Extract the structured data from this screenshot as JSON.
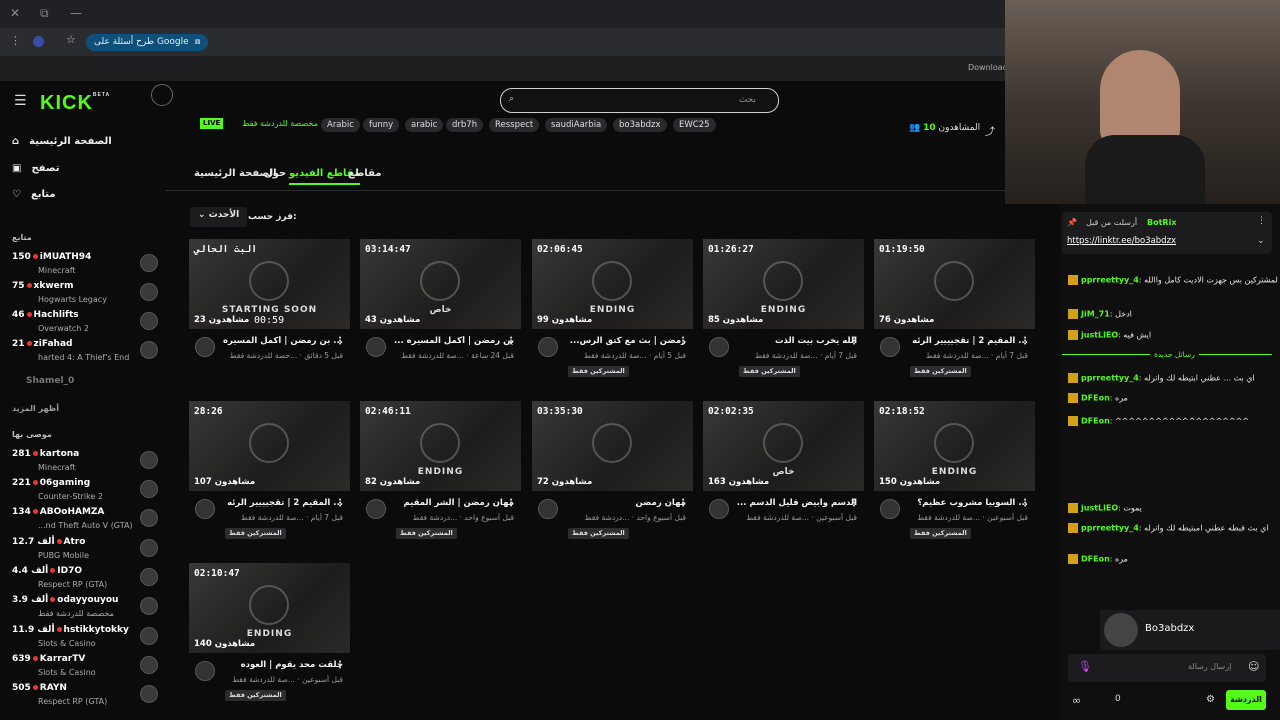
{
  "browser": {
    "window_controls": [
      "✕",
      "⧉",
      "—"
    ],
    "google_chip": "طرح أسئلة على Google",
    "download_label": "Download"
  },
  "header": {
    "logo": "KICK",
    "logo_sup": "BETA",
    "search_placeholder": "بحث"
  },
  "sidebar": {
    "nav": [
      {
        "label": "الصفحة الرئيسية",
        "icon": "home-icon"
      },
      {
        "label": "تصفح",
        "icon": "browse-icon"
      },
      {
        "label": "متابع",
        "icon": "heart-icon"
      }
    ],
    "following_title": "متابع",
    "following": [
      {
        "count": "150",
        "name": "iMUATH94",
        "game": "Minecraft"
      },
      {
        "count": "75",
        "name": "xkwerm",
        "game": "Hogwarts Legacy"
      },
      {
        "count": "46",
        "name": "Hachlifts",
        "game": "Overwatch 2"
      },
      {
        "count": "21",
        "name": "ziFahad",
        "game": "harted 4: A Thief's End"
      }
    ],
    "offline_name": "Shamel_0",
    "show_more": "أظهر المزيد",
    "recommended_title": "موصى بها",
    "recommended": [
      {
        "count": "281",
        "name": "kartona",
        "game": "Minecraft"
      },
      {
        "count": "221",
        "name": "06gaming",
        "game": "Counter-Strike 2"
      },
      {
        "count": "134",
        "name": "ABOoHAMZA",
        "game": "...nd Theft Auto V (GTA)"
      },
      {
        "count": "12.7 ألف",
        "name": "Atro",
        "game": "PUBG Mobile"
      },
      {
        "count": "4.4 ألف",
        "name": "ID7O",
        "game": "Respect RP (GTA)"
      },
      {
        "count": "3.9 ألف",
        "name": "odayyouyou",
        "game": "مخصصة للدردشة فقط"
      },
      {
        "count": "11.9 ألف",
        "name": "hstikkytokky",
        "game": "Slots & Casino"
      },
      {
        "count": "639",
        "name": "KarrarTV",
        "game": "Slots & Casino"
      },
      {
        "count": "505",
        "name": "RAYN",
        "game": "Respect RP (GTA)"
      }
    ]
  },
  "channel": {
    "live_badge": "LIVE",
    "category": "مخصصة للدردشة فقط",
    "tags": [
      "Arabic",
      "funny",
      "arabic",
      "drb7h",
      "Resspect",
      "saudiAarbia",
      "bo3abdzx",
      "EWC25"
    ],
    "followers_label": "المشاهدون",
    "followers_count": "10",
    "tabs": [
      "الصفحة الرئيسية",
      "حول",
      "مقاطع الفيديو",
      "مقاطع"
    ],
    "sort_label": "فرز حسب:",
    "sort_value": "الأحدث"
  },
  "videos": [
    {
      "dur": "البث الحالي",
      "views": "23 مشاهدون",
      "over": "STARTING SOON",
      "title": "... بن رمضن | أكمل المسيره",
      "meta": "قبل 5 دقائق · ...حصة للدردشة فقط",
      "sub": "",
      "time_code": "00:59"
    },
    {
      "dur": "03:14:47",
      "views": "43 مشاهدون",
      "over": "خاص",
      "title": "بن رمضن | أكمل المسيره ...",
      "meta": "قبل 24 ساعة · ...صة للدردشة فقط",
      "sub": ""
    },
    {
      "dur": "02:06:45",
      "views": "99 مشاهدون",
      "over": "ENDING",
      "title": "رمضن | بث مع كتق الرس...",
      "meta": "قبل 5 أيام · ...صة للدردشة فقط",
      "sub": "المشتركين فقط"
    },
    {
      "dur": "01:26:27",
      "views": "85 مشاهدون",
      "over": "ENDING",
      "title": "الله يخرب بيت الذت",
      "meta": "قبل 7 أيام · ...صة للدردشة فقط",
      "sub": "المشتركين فقط"
    },
    {
      "dur": "01:19:50",
      "views": "76 مشاهدون",
      "over": "",
      "title": "... المقيم 2 | تقجيييير الرئه",
      "meta": "قبل 7 أيام · ...صة للدردشة فقط",
      "sub": "المشتركين فقط"
    },
    {
      "dur": "28:26",
      "views": "107 مشاهدون",
      "over": "",
      "title": "... المقيم 2 | تقجيييير الرئه",
      "meta": "قبل 7 أيام · ...صة للدردشة فقط",
      "sub": "المشتركين فقط"
    },
    {
      "dur": "02:46:11",
      "views": "82 مشاهدون",
      "over": "ENDING",
      "title": "مهان رمضن | الشر المقيم",
      "meta": "قبل أسبوع واحد · ...دردشة فقط",
      "sub": "المشتركين فقط"
    },
    {
      "dur": "03:35:30",
      "views": "72 مشاهدون",
      "over": "",
      "title": "مهان رمضن",
      "meta": "قبل أسبوع واحد · ...دردشة فقط",
      "sub": "المشتركين فقط"
    },
    {
      "dur": "02:02:35",
      "views": "163 مشاهدون",
      "over": "خاص",
      "title": "الدسم وابيض قليل الدسم ...",
      "meta": "قبل أسبوعين · ...صة للدردشة فقط",
      "sub": ""
    },
    {
      "dur": "02:18:52",
      "views": "150 مشاهدون",
      "over": "ENDING",
      "title": "... السوبيا مشروب عظيم؟",
      "meta": "قبل أسبوعين · ...صة للدردشة فقط",
      "sub": "المشتركين فقط"
    },
    {
      "dur": "02:10:47",
      "views": "140 مشاهدون",
      "over": "ENDING",
      "title": "حلقت محد يقوم | العوده",
      "meta": "قبل أسبوعين · ...صة للدردشة فقط",
      "sub": "المشتركين فقط"
    }
  ],
  "chat": {
    "pinned_by": "أرسلت من قبل",
    "pinned_user": "BotRix",
    "pinned_link": "https://linktr.ee/bo3abdzx",
    "new_messages": "رسائل جديدة",
    "messages": [
      {
        "user": "pprreettyy_4",
        "text": "والله حرام عليك حافظ البث المحتوط المشتركين بس جهزت الاديت كامل واالله"
      },
      {
        "user": "JiM_71",
        "text": "ادخل"
      },
      {
        "user": "justLlEO",
        "text": "ايش فيه"
      },
      {
        "user": "pprreettyy_4",
        "text": "اي بث ... عطني ابتيطه لك واترله"
      },
      {
        "user": "DFEon",
        "text": "مره"
      },
      {
        "user": "DFEon",
        "text": "^^^^^^^^^^^^^^^^^^^^"
      },
      {
        "user": "justLlEO",
        "text": "يموت"
      },
      {
        "user": "pprreettyy_4",
        "text": "اي بث قبطه عطني امبتيطه لك واترله"
      },
      {
        "user": "DFEon",
        "text": "مره"
      }
    ],
    "streamer_name": "Bo3abdzx",
    "input_placeholder": "إرسال رسالة",
    "chat_button": "الدردشة",
    "points": "0"
  }
}
